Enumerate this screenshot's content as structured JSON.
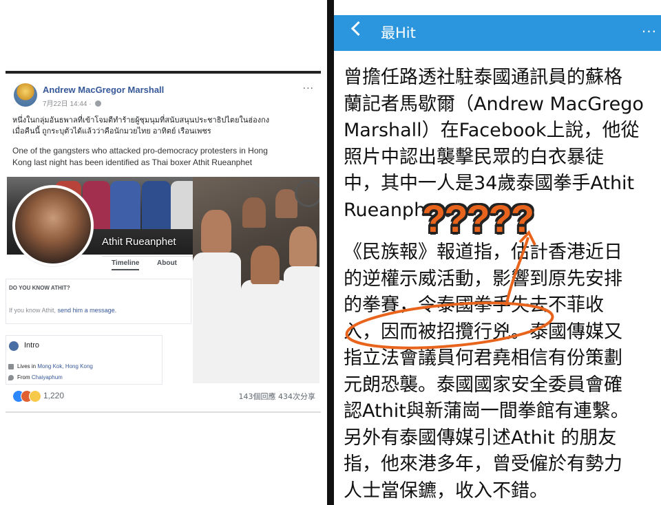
{
  "left_post": {
    "author": "Andrew MacGregor Marshall",
    "timestamp": "7月22日 14:44 ·",
    "more": "···",
    "thai_text_line1": "หนึ่งในกลุ่มอันธพาลที่เข้าโจมตีทำร้ายผู้ชุมนุมที่สนับสนุนประชาธิปไตยในฮ่องกง",
    "thai_text_line2": "เมื่อคืนนี้ ถูกระบุตัวได้แล้วว่าคือนักมวยไทย อาทิตย์ เรือนเพชร",
    "english_text_line1": "One of the gangsters who attacked pro-democracy protesters in Hong",
    "english_text_line2": "Kong last night has been identified as Thai boxer Athit Rueanphet",
    "profile_name": "Athit Rueanphet",
    "tabs": [
      "Timeline",
      "About"
    ],
    "know_title": "DO YOU KNOW ATHIT?",
    "know_text_prefix": "If you know Athit,",
    "know_link": "send him a message.",
    "intro_title": "Intro",
    "lives_label": "Lives in",
    "lives_value": "Mong Kok, Hong Kong",
    "from_label": "From",
    "from_value": "Chaiyaphum",
    "reaction_count": "1,220",
    "comments": "143個回應",
    "shares": "434次分享",
    "icons": [
      "globe-icon",
      "like-icon",
      "angry-icon",
      "wow-icon",
      "location-icon",
      "home-icon"
    ]
  },
  "right_article": {
    "header_title": "最Hit",
    "header_more": "···",
    "paragraph1": "曾擔任路透社駐泰國通訊員的蘇格\n蘭記者馬歇爾（Andrew MacGrego\nMarshall）在Facebook上說，他從\n照片中認出襲擊民眾的白衣暴徒\n中，其中一人是34歲泰國拳手Athit\nRueanphet。",
    "paragraph2": "《民族報》報道指，估計香港近日\n的逆權示威活動，影響到原先安排\n的拳賽，令泰國拳手失去不菲收\n入，因而被招攬行兇。泰國傳媒又\n指立法會議員何君堯相信有份策劃\n元朗恐襲。泰國國家安全委員會確\n認Athit與新蒲崗一間拳館有連繫。\n另外有泰國傳媒引述Athit 的朋友\n指，他來港多年，曾受僱於有勢力\n人士當保鑣，收入不錯。",
    "overlay_question_marks": "?????",
    "accent_color": "#2b95dd",
    "annotation_color": "#e8641c"
  }
}
